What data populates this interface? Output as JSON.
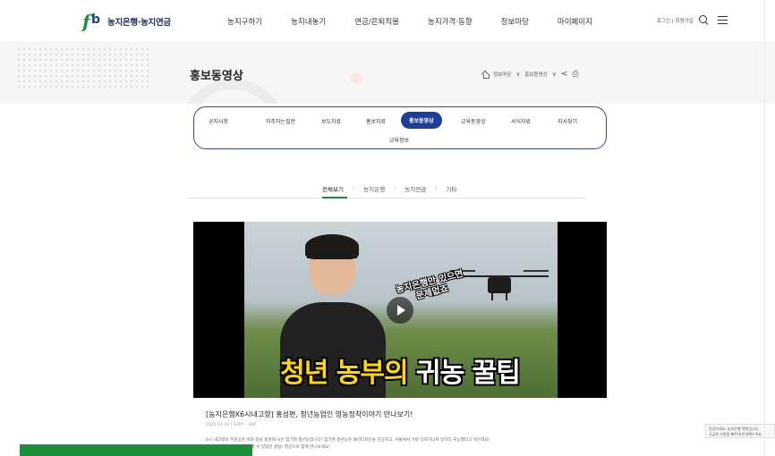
{
  "header": {
    "logo_text": "농지은행·농지연금",
    "nav": [
      "농지구하기",
      "농지내놓기",
      "연금/은퇴직불",
      "농지가격·동향",
      "정보마당",
      "마이페이지"
    ],
    "util_text": "로그인 | 회원가입"
  },
  "page": {
    "title": "홍보동영상",
    "breadcrumb": [
      "정보마당",
      "홍보동영상"
    ]
  },
  "tabs": {
    "row1": [
      "공지사항",
      "자주하는질문",
      "보도자료",
      "홍보자료",
      "홍보동영상",
      "교육동영상",
      "서식자료",
      "지사찾기"
    ],
    "row2": [
      "교육정보"
    ],
    "active": "홍보동영상"
  },
  "subtabs": {
    "items": [
      "전체보기",
      "농지은행",
      "농지연금",
      "기타"
    ],
    "active": "전체보기"
  },
  "video": {
    "bubble_line1": "농지은행만 있으면",
    "bubble_line2": "문제없죠",
    "caption_yellow": "청년 농부의",
    "caption_white": "귀농 꿀팁"
  },
  "post": {
    "title": "[농지은행X6시내고향] 홍성편, 청년농업인 영농정착이야기 만나보기!",
    "meta": "2025-11-10 | 조회수 : 349",
    "desc_line1": "6시 내고향의 추천공은 바로 충남 홍성에 사는 엄기현 청년농업니다! 엄기현 청년농은 패션디자인을 전공하고, 서울에서 가방 디자이너로 일하다 귀농했다고 하는데요!",
    "desc_line2": "엄기현 청년농의 팔~ 정착률 수 있었던 꿀팁! 영상으로 함께 만나보세요!"
  },
  "side_widget": {
    "line1": "안녕하세요, 농지은행 챗봇입니다.",
    "line2": "궁금한 사항을 빠르게 안내해드려요"
  },
  "colors": {
    "brand_blue": "#1f3d99",
    "brand_green": "#1d8f3b"
  }
}
